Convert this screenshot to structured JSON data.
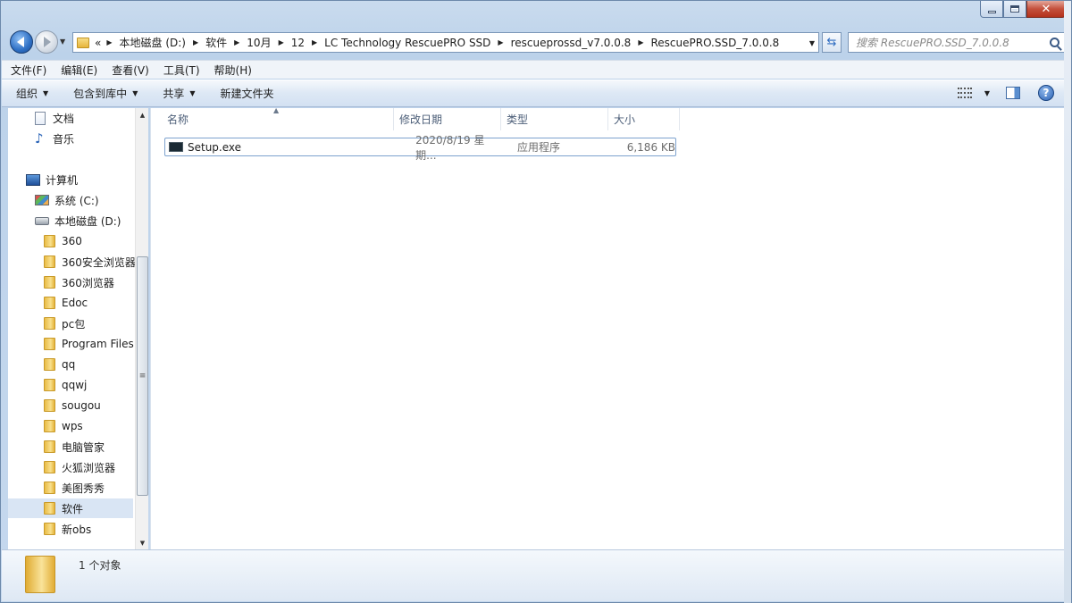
{
  "window": {
    "controls": {
      "minimize": "minimize",
      "maximize": "maximize",
      "close": "close"
    }
  },
  "nav": {
    "address_crumbs": [
      "本地磁盘 (D:)",
      "软件",
      "10月",
      "12",
      "LC Technology RescuePRO SSD",
      "rescueprossd_v7.0.0.8",
      "RescuePRO.SSD_7.0.0.8"
    ],
    "overflow_label": "«",
    "search_placeholder": "搜索 RescuePRO.SSD_7.0.0.8"
  },
  "menubar": {
    "items": [
      "文件(F)",
      "编辑(E)",
      "查看(V)",
      "工具(T)",
      "帮助(H)"
    ]
  },
  "cmdbar": {
    "organize": "组织",
    "include_library": "包含到库中",
    "share": "共享",
    "new_folder": "新建文件夹"
  },
  "sidebar": {
    "items": [
      {
        "label": "文档",
        "icon": "document-icon"
      },
      {
        "label": "音乐",
        "icon": "music-icon"
      },
      {
        "label": "计算机",
        "icon": "computer-icon"
      },
      {
        "label": "系统 (C:)",
        "icon": "system-drive-icon"
      },
      {
        "label": "本地磁盘 (D:)",
        "icon": "drive-icon"
      },
      {
        "label": "360",
        "icon": "folder-icon"
      },
      {
        "label": "360安全浏览器",
        "icon": "folder-icon"
      },
      {
        "label": "360浏览器",
        "icon": "folder-icon"
      },
      {
        "label": "Edoc",
        "icon": "folder-icon"
      },
      {
        "label": "pc包",
        "icon": "folder-icon"
      },
      {
        "label": "Program Files",
        "icon": "folder-icon"
      },
      {
        "label": "qq",
        "icon": "folder-icon"
      },
      {
        "label": "qqwj",
        "icon": "folder-icon"
      },
      {
        "label": "sougou",
        "icon": "folder-icon"
      },
      {
        "label": "wps",
        "icon": "folder-icon"
      },
      {
        "label": "电脑管家",
        "icon": "folder-icon"
      },
      {
        "label": "火狐浏览器",
        "icon": "folder-icon"
      },
      {
        "label": "美图秀秀",
        "icon": "folder-icon"
      },
      {
        "label": "软件",
        "icon": "folder-icon",
        "selected": true
      },
      {
        "label": "新obs",
        "icon": "folder-icon"
      }
    ]
  },
  "content": {
    "columns": [
      "名称",
      "修改日期",
      "类型",
      "大小"
    ],
    "files": [
      {
        "name": "Setup.exe",
        "date": "2020/8/19 星期...",
        "type": "应用程序",
        "size": "6,186 KB"
      }
    ]
  },
  "details": {
    "summary": "1 个对象"
  }
}
